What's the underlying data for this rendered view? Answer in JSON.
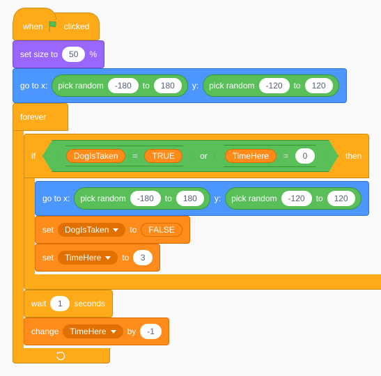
{
  "hat": {
    "prefix": "when",
    "suffix": "clicked"
  },
  "setSize": {
    "label_pre": "set size to",
    "value": "50",
    "label_post": "%"
  },
  "goto1": {
    "go_x": "go to x:",
    "y": "y:",
    "pick": "pick random",
    "to": "to",
    "x_min": "-180",
    "x_max": "180",
    "y_min": "-120",
    "y_max": "120"
  },
  "forever": {
    "label": "forever"
  },
  "if": {
    "if": "if",
    "then": "then",
    "or": "or",
    "eq": "=",
    "varA": "DogIsTaken",
    "valA": "TRUE",
    "varB": "TimeHere",
    "valB": "0"
  },
  "goto2": {
    "go_x": "go to x:",
    "y": "y:",
    "pick": "pick random",
    "to": "to",
    "x_min": "-180",
    "x_max": "180",
    "y_min": "-120",
    "y_max": "120"
  },
  "setVarA": {
    "set": "set",
    "var": "DogIsTaken",
    "to": "to",
    "val": "FALSE"
  },
  "setVarB": {
    "set": "set",
    "var": "TimeHere",
    "to": "to",
    "val": "3"
  },
  "wait": {
    "wait": "wait",
    "val": "1",
    "seconds": "seconds"
  },
  "change": {
    "change": "change",
    "var": "TimeHere",
    "by": "by",
    "val": "-1"
  }
}
